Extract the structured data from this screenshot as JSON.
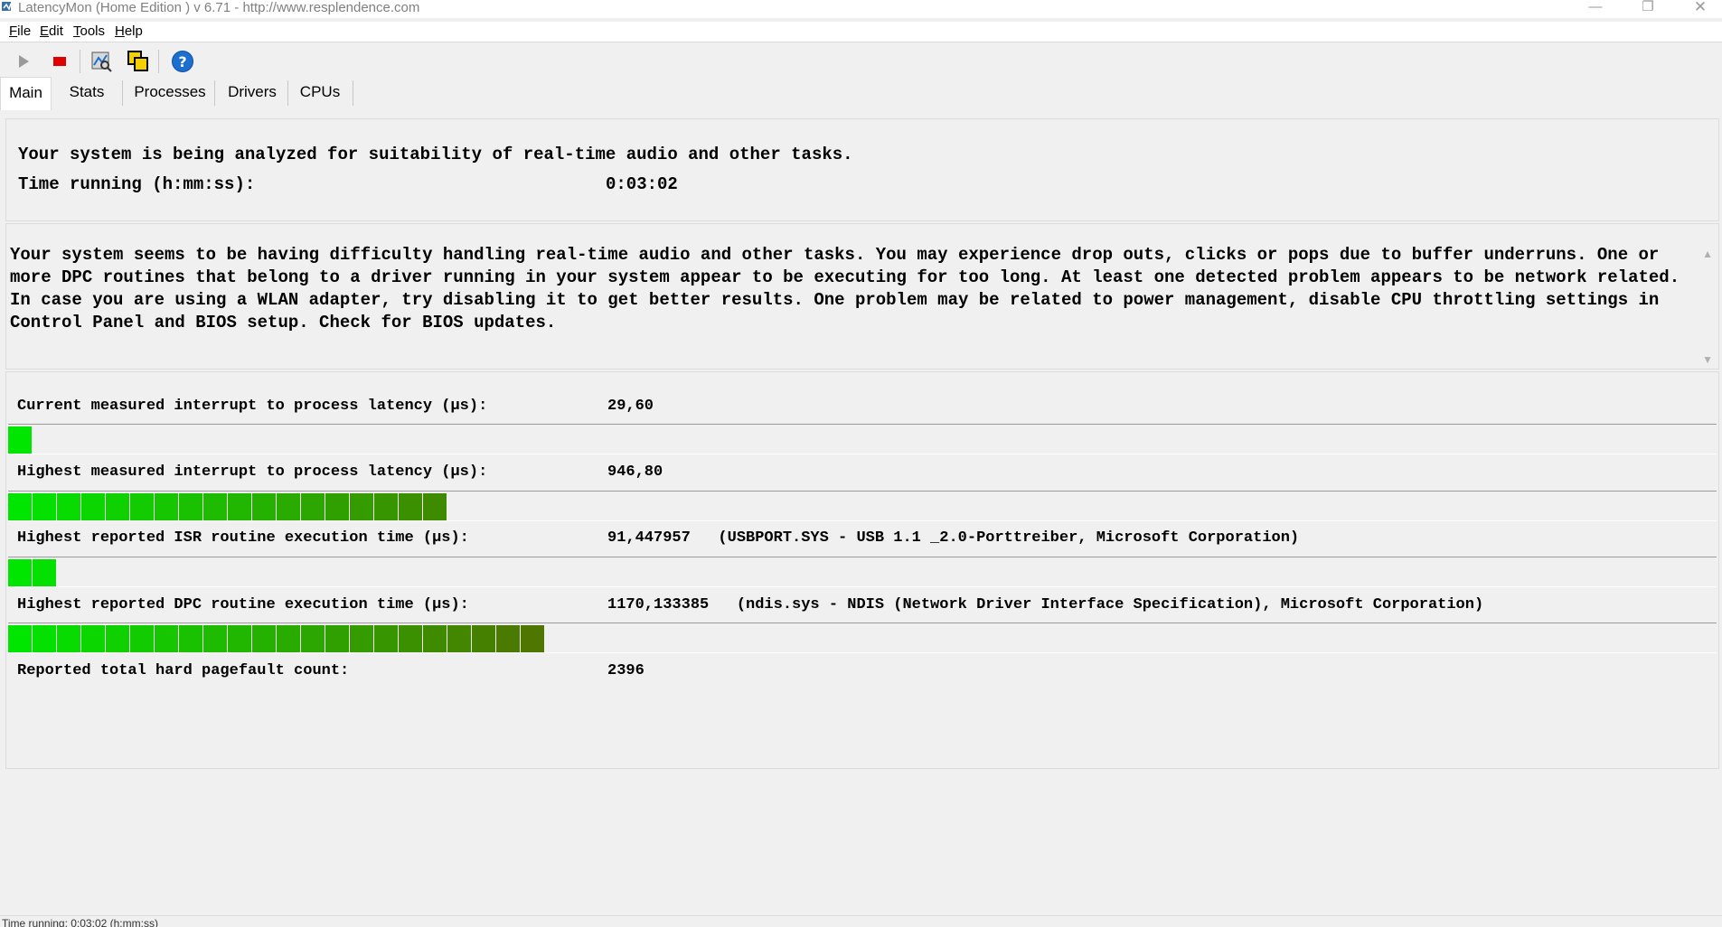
{
  "window": {
    "title": "LatencyMon  (Home Edition )  v 6.71 - http://www.resplendence.com",
    "minimize_glyph": "—",
    "maximize_glyph": "❐",
    "close_glyph": "✕"
  },
  "menu": {
    "items": [
      {
        "label": "File",
        "accel": "F",
        "rest": "ile"
      },
      {
        "label": "Edit",
        "accel": "E",
        "rest": "dit"
      },
      {
        "label": "Tools",
        "accel": "T",
        "rest": "ools"
      },
      {
        "label": "Help",
        "accel": "H",
        "rest": "elp"
      }
    ]
  },
  "toolbar": {
    "icons": [
      "play-icon",
      "stop-icon",
      "analyze-icon",
      "copy-icon",
      "help-icon"
    ],
    "colors": {
      "play": "#9a9a9a",
      "stop": "#e00000",
      "help": "#1c6fd1"
    }
  },
  "tabs": {
    "items": [
      "Main",
      "Stats",
      "Processes",
      "Drivers",
      "CPUs"
    ],
    "active": "Main"
  },
  "status": {
    "line1": "Your system is being analyzed for suitability of real-time audio and other tasks.",
    "time_label": "Time running (h:mm:ss):",
    "time_value": "0:03:02"
  },
  "analysis": {
    "text": "Your system seems to be having difficulty handling real-time audio and other tasks. You may experience drop outs, clicks or pops due to buffer underruns. One or more DPC routines that belong to a driver running in your system appear to be executing for too long. At least one detected problem appears to be network related. In case you are using a WLAN adapter, try disabling it to get better results. One problem may be related to power management, disable CPU throttling settings in Control Panel and BIOS setup. Check for BIOS updates."
  },
  "metrics": {
    "current_latency": {
      "label": "Current measured interrupt to process latency (µs):",
      "value": "29,60",
      "meter_segments": 1
    },
    "highest_latency": {
      "label": "Highest measured interrupt to process latency (µs):",
      "value": "946,80",
      "meter_segments": 18
    },
    "isr": {
      "label": "Highest reported ISR routine execution time (µs):",
      "value": "91,447957   (USBPORT.SYS - USB 1.1 _2.0-Porttreiber, Microsoft Corporation)",
      "meter_segments": 2
    },
    "dpc": {
      "label": "Highest reported DPC routine execution time (µs):",
      "value": "1170,133385   (ndis.sys - NDIS (Network Driver Interface Specification), Microsoft Corporation)",
      "meter_segments": 22
    },
    "pagefault": {
      "label": "Reported total hard pagefault count:",
      "value": "2396"
    }
  },
  "meter_colors": {
    "start": "#00e600",
    "end": "#556b00"
  },
  "statusbar": {
    "text": "Time running: 0:03:02  (h:mm:ss)"
  }
}
